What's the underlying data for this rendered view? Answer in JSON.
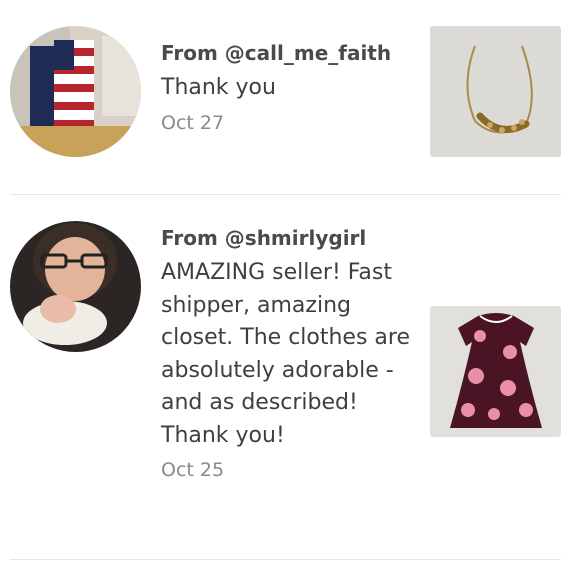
{
  "reviews": [
    {
      "from": "From @call_me_faith",
      "message": "Thank you",
      "date": "Oct 27",
      "avatar_icon": "user-avatar-flag",
      "item_icon": "gold-necklace"
    },
    {
      "from": "From @shmirlygirl",
      "message": "AMAZING seller! Fast shipper, amazing closet. The clothes are absolutely adorable - and as described! Thank you!",
      "date": "Oct 25",
      "avatar_icon": "user-avatar-mother-baby",
      "item_icon": "floral-toddler-dress"
    }
  ]
}
